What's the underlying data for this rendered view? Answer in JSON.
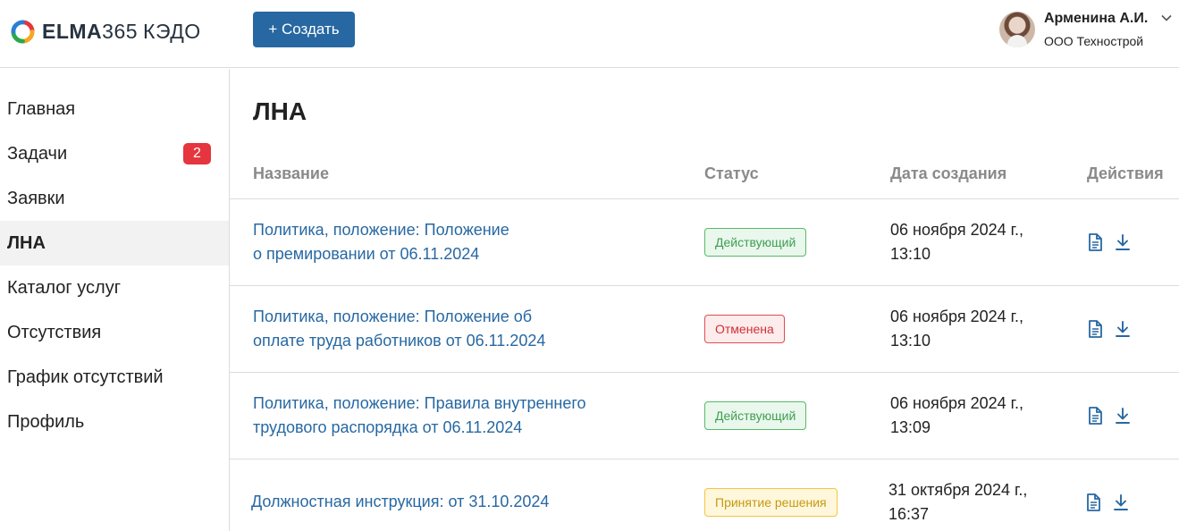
{
  "brand": {
    "name_bold": "ELMA",
    "name_num": "365",
    "name_product": "КЭДО"
  },
  "header": {
    "create_label": "+ Создать"
  },
  "user": {
    "name": "Арменина А.И.",
    "org": "ООО Технострой"
  },
  "sidebar": {
    "items": [
      {
        "label": "Главная"
      },
      {
        "label": "Задачи",
        "badge": "2"
      },
      {
        "label": "Заявки"
      },
      {
        "label": "ЛНА",
        "active": true
      },
      {
        "label": "Каталог услуг"
      },
      {
        "label": "Отсутствия"
      },
      {
        "label": "График отсутствий"
      },
      {
        "label": "Профиль"
      }
    ]
  },
  "main": {
    "title": "ЛНА",
    "columns": {
      "name": "Название",
      "status": "Статус",
      "date": "Дата создания",
      "actions": "Действия"
    },
    "rows": [
      {
        "name_line1": "Политика, положение: Положение",
        "name_line2": "о премировании от 06.11.2024",
        "status": "Действующий",
        "status_kind": "active",
        "date_line1": "06 ноября 2024 г.,",
        "date_line2": "13:10"
      },
      {
        "name_line1": "Политика, положение: Положение об",
        "name_line2": "оплате труда работников от 06.11.2024",
        "status": "Отменена",
        "status_kind": "cancel",
        "date_line1": "06 ноября 2024 г.,",
        "date_line2": "13:10"
      },
      {
        "name_line1": "Политика, положение: Правила внутреннего",
        "name_line2": "трудового распорядка от 06.11.2024",
        "status": "Действующий",
        "status_kind": "active",
        "date_line1": "06 ноября 2024 г.,",
        "date_line2": "13:09"
      },
      {
        "name_line1": "Должностная инструкция: от 31.10.2024",
        "name_line2": "",
        "status": "Принятие решения",
        "status_kind": "pending",
        "date_line1": "31 октября 2024 г.,",
        "date_line2": "16:37"
      }
    ],
    "action_icons": [
      "document-icon",
      "download-icon"
    ]
  },
  "colors": {
    "accent": "#2768a2",
    "badge": "#e5353f",
    "active_status": "#3e9f53",
    "cancel_status": "#d02f37",
    "pending_status": "#c59a10"
  }
}
